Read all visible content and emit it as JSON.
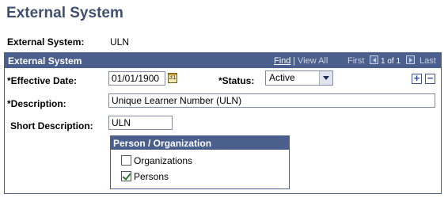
{
  "page": {
    "title": "External System"
  },
  "summary": {
    "label": "External System:",
    "value": "ULN"
  },
  "section": {
    "title": "External System",
    "nav": {
      "find": "Find",
      "separator": "|",
      "view_all": "View All",
      "first": "First",
      "position": "1 of 1",
      "last": "Last"
    }
  },
  "fields": {
    "effective_date": {
      "label": "*Effective Date:",
      "value": "01/01/1900"
    },
    "status": {
      "label": "*Status:",
      "value": "Active"
    },
    "description": {
      "label": "*Description:",
      "value": "Unique Learner Number (ULN)"
    },
    "short_description": {
      "label": "Short Description:",
      "value": "ULN"
    }
  },
  "person_org": {
    "title": "Person / Organization",
    "options": [
      {
        "label": "Organizations",
        "checked": false
      },
      {
        "label": "Persons",
        "checked": true
      }
    ]
  },
  "buttons": {
    "add": "+",
    "remove": "−"
  },
  "icons": {
    "calendar": "calendar-icon",
    "dropdown": "chevron-down-icon"
  },
  "colors": {
    "header_bg": "#4b5f8d",
    "title": "#3f4f6f"
  }
}
